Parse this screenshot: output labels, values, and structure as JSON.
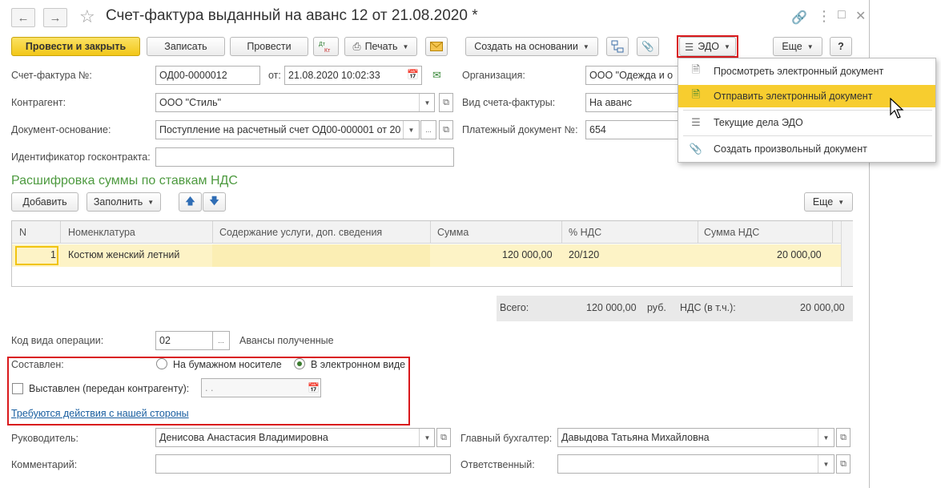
{
  "window": {
    "title": "Счет-фактура выданный на аванс 12 от 21.08.2020 *"
  },
  "toolbar": {
    "post_close": "Провести и закрыть",
    "save": "Записать",
    "post": "Провести",
    "dt_kt": "Дт Кт",
    "print": "Печать",
    "create_based": "Создать на основании",
    "edo": "ЭДО",
    "more": "Еще",
    "help": "?"
  },
  "form": {
    "invoice_label": "Счет-фактура №:",
    "invoice_number": "ОД00-0000012",
    "from_label": "от:",
    "date": "21.08.2020 10:02:33",
    "org_label": "Организация:",
    "org_value": "ООО \"Одежда и о",
    "counterparty_label": "Контрагент:",
    "counterparty_value": "ООО \"Стиль\"",
    "invoice_type_label": "Вид счета-фактуры:",
    "invoice_type_value": "На аванс",
    "base_doc_label": "Документ-основание:",
    "base_doc_value": "Поступление на расчетный счет ОД00-000001 от 20",
    "payment_doc_label": "Платежный документ №:",
    "payment_doc_value": "654",
    "gov_contract_label": "Идентификатор госконтракта:",
    "gov_contract_value": ""
  },
  "vat_section": {
    "title": "Расшифровка суммы по ставкам НДС",
    "add": "Добавить",
    "fill": "Заполнить",
    "more": "Еще",
    "columns": [
      "N",
      "Номенклатура",
      "Содержание услуги, доп. сведения",
      "Сумма",
      "% НДС",
      "Сумма НДС"
    ],
    "rows": [
      {
        "n": "1",
        "item": "Костюм женский летний",
        "content": "",
        "sum": "120 000,00",
        "vat_rate": "20/120",
        "vat_sum": "20 000,00"
      }
    ],
    "totals": {
      "total_label": "Всего:",
      "total_value": "120 000,00",
      "currency": "руб.",
      "vat_label": "НДС (в т.ч.):",
      "vat_value": "20 000,00"
    }
  },
  "operation": {
    "label": "Код вида операции:",
    "code": "02",
    "description": "Авансы полученные"
  },
  "compiled": {
    "label": "Составлен:",
    "paper": "На бумажном носителе",
    "electronic": "В электронном виде",
    "selected": "electronic",
    "issued_label": "Выставлен (передан контрагенту):",
    "issued_date_placeholder": " .  .",
    "action_link": "Требуются действия с нашей стороны"
  },
  "footer": {
    "head_label": "Руководитель:",
    "head_value": "Денисова Анастасия Владимировна",
    "accountant_label": "Главный бухгалтер:",
    "accountant_value": "Давыдова Татьяна Михайловна",
    "comment_label": "Комментарий:",
    "comment_value": "",
    "responsible_label": "Ответственный:",
    "responsible_value": ""
  },
  "edo_menu": {
    "items": [
      {
        "label": "Просмотреть электронный документ",
        "icon": "document-icon"
      },
      {
        "label": "Отправить электронный документ",
        "icon": "send-document-icon"
      },
      {
        "label": "Текущие дела ЭДО",
        "icon": "tasks-list-icon"
      },
      {
        "label": "Создать произвольный документ",
        "icon": "paperclip-icon"
      }
    ],
    "active_index": 1
  },
  "colors": {
    "primary_button": "#f2c718",
    "highlight_red": "#d9181c",
    "section_green": "#4d9a3f",
    "menu_active": "#f7cd2f",
    "row_selected": "#fdf3c6"
  }
}
